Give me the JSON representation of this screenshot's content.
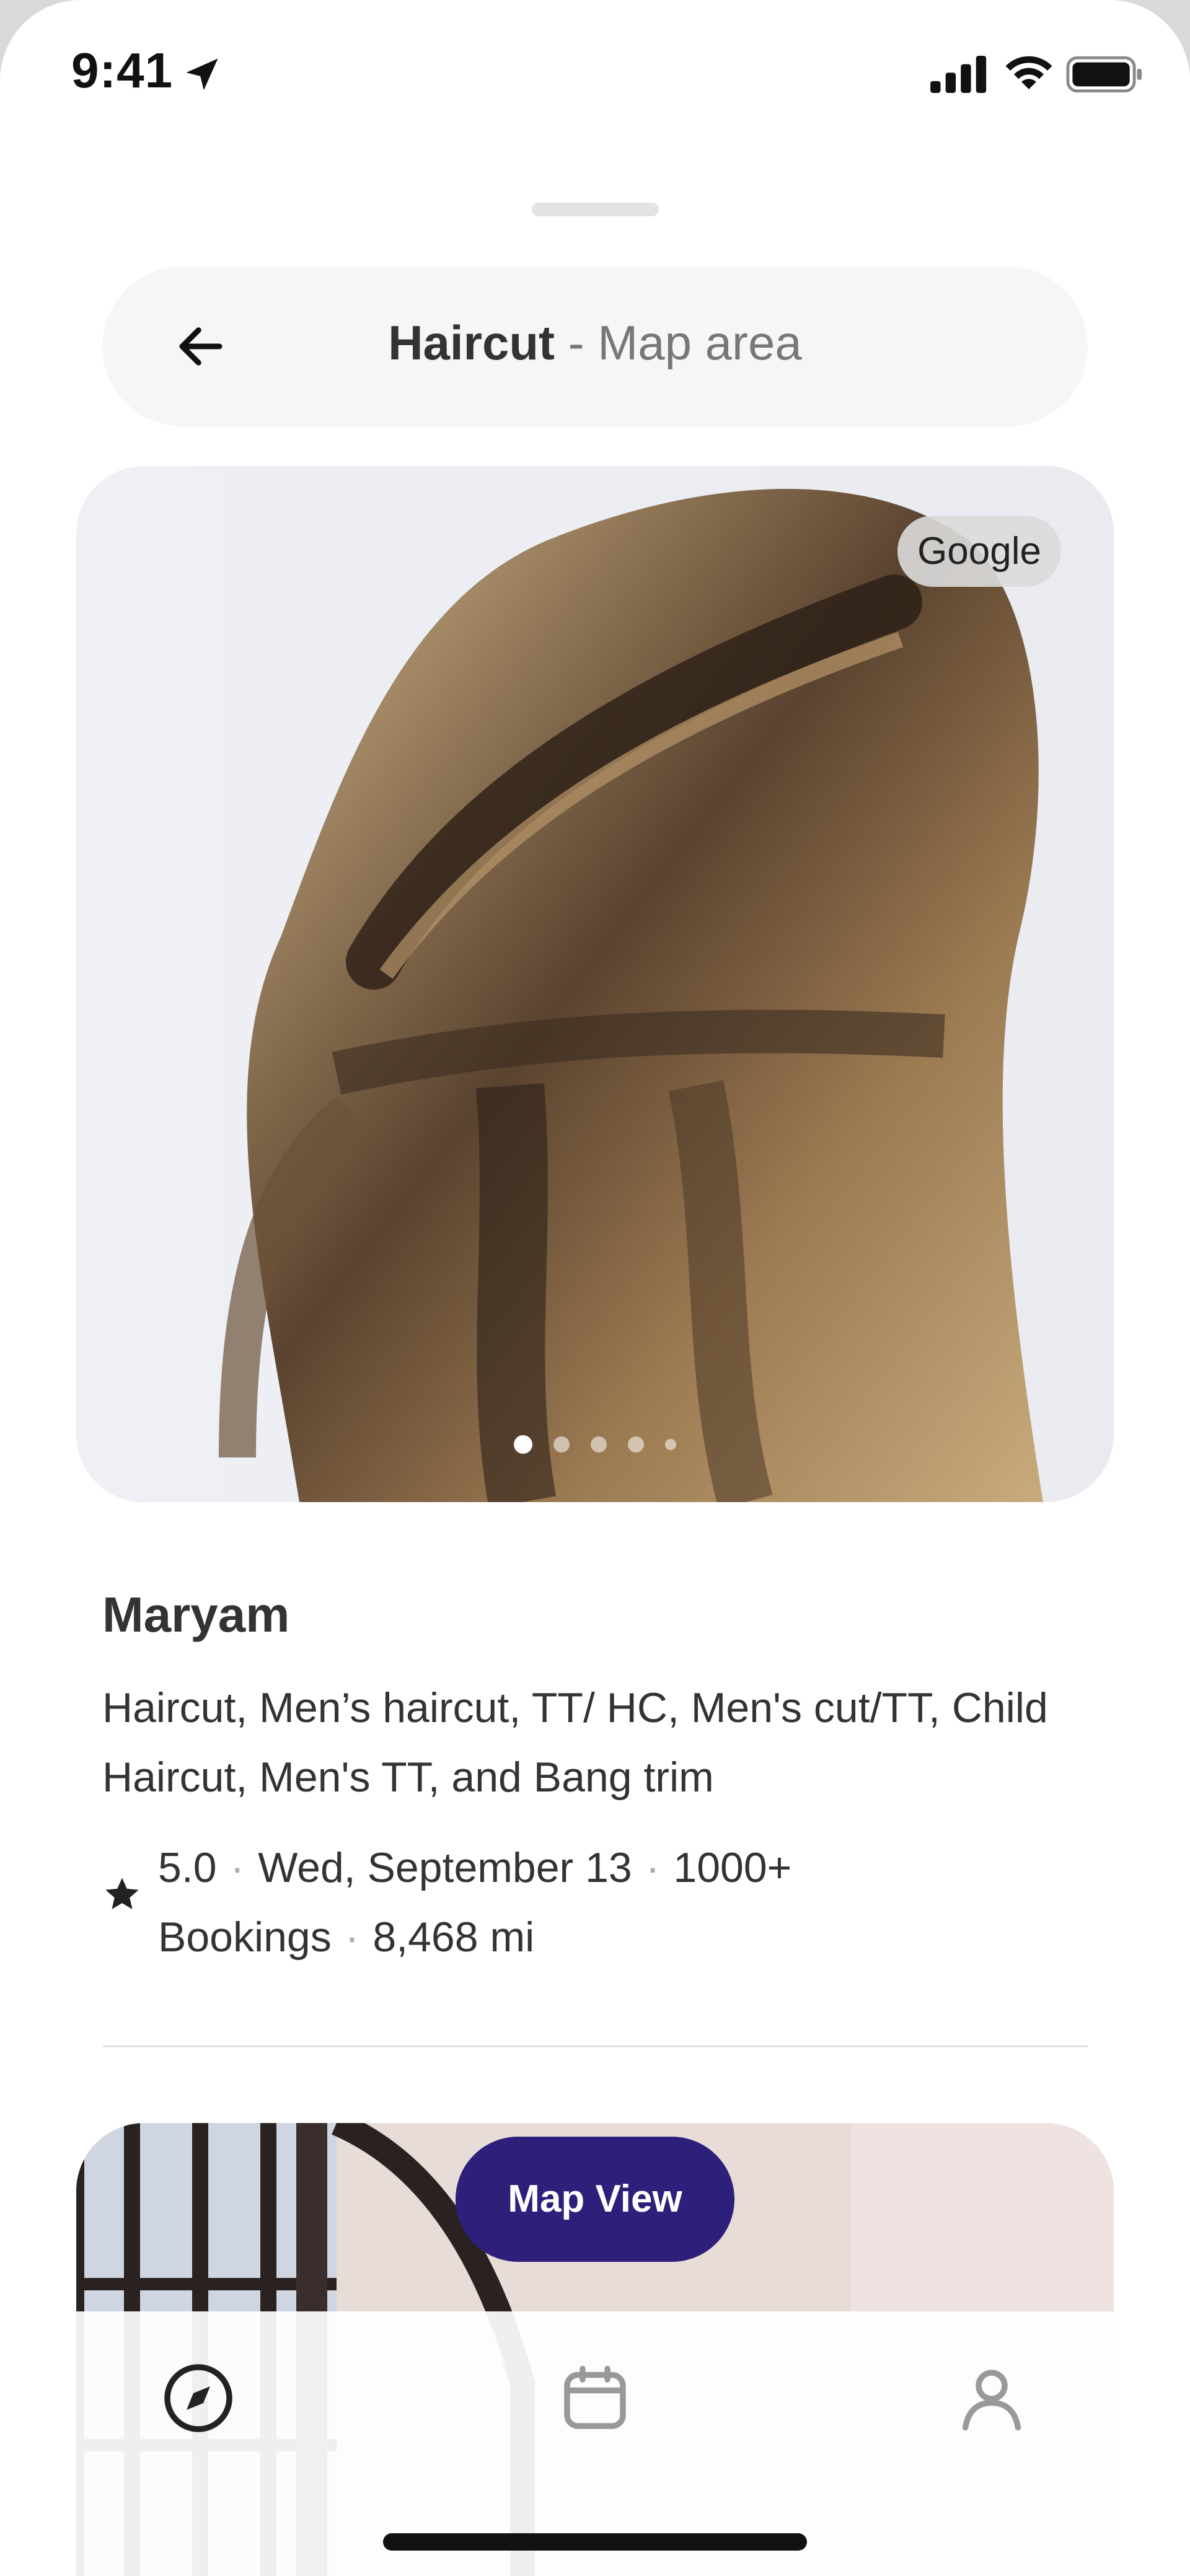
{
  "status_bar": {
    "time": "9:41",
    "icons": [
      "location-arrow-icon",
      "cellular-signal-icon",
      "wifi-icon",
      "battery-icon"
    ]
  },
  "search": {
    "back_icon": "arrow-left-icon",
    "title_main": "Haircut",
    "title_sub": "- Map area"
  },
  "listing": {
    "image_badge": "Google",
    "carousel": {
      "count": 5,
      "active_index": 0
    },
    "name": "Maryam",
    "services": "Haircut, Men’s haircut, TT/ HC, Men's cut/TT, Child Haircut, Men's TT, and Bang trim",
    "rating": "5.0",
    "date": "Wed, September 13",
    "bookings": "1000+ Bookings",
    "distance": "8,468 mi",
    "rating_icon": "star-icon"
  },
  "map_view_button": "Map View",
  "tab_bar": {
    "tabs": [
      {
        "name": "explore",
        "icon": "compass-icon",
        "active": true
      },
      {
        "name": "appointments",
        "icon": "calendar-icon",
        "active": false
      },
      {
        "name": "profile",
        "icon": "person-icon",
        "active": false
      }
    ]
  },
  "colors": {
    "accent": "#2d1f7a",
    "search_bg": "#f6f6f6",
    "text_primary": "#333333",
    "text_secondary": "#777777"
  }
}
